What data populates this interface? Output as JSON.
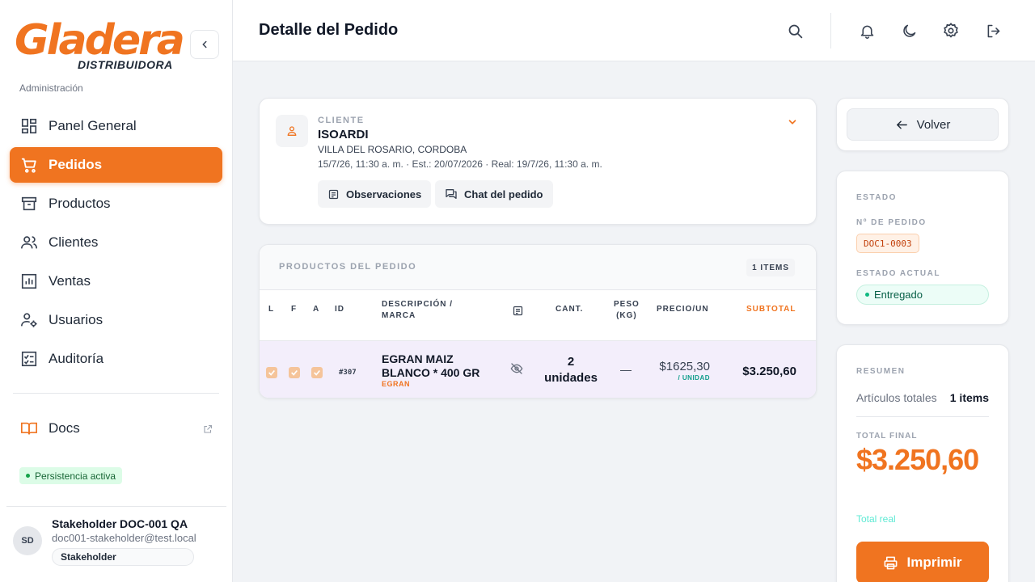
{
  "brand": {
    "logo_main": "Gladera",
    "logo_sub": "DISTRIBUIDORA",
    "accent": "#f07420"
  },
  "sidebar": {
    "section_label": "Administración",
    "items": [
      {
        "label": "Panel General",
        "icon": "dashboard-icon",
        "active": false
      },
      {
        "label": "Pedidos",
        "icon": "cart-icon",
        "active": true
      },
      {
        "label": "Productos",
        "icon": "archive-icon",
        "active": false
      },
      {
        "label": "Clientes",
        "icon": "users-icon",
        "active": false
      },
      {
        "label": "Ventas",
        "icon": "chart-icon",
        "active": false
      },
      {
        "label": "Usuarios",
        "icon": "user-settings-icon",
        "active": false
      },
      {
        "label": "Auditoría",
        "icon": "checklist-icon",
        "active": false
      }
    ],
    "docs_label": "Docs",
    "persistence": "Persistencia activa",
    "user": {
      "initials": "SD",
      "name": "Stakeholder DOC-001 QA",
      "email": "doc001-stakeholder@test.local",
      "role": "Stakeholder"
    }
  },
  "header": {
    "title": "Detalle del Pedido"
  },
  "client": {
    "label": "CLIENTE",
    "name": "ISOARDI",
    "location": "VILLA DEL ROSARIO, CORDOBA",
    "dates": "15/7/26, 11:30 a. m. · Est.: 20/07/2026 · Real: 19/7/26, 11:30 a. m.",
    "observations_label": "Observaciones",
    "chat_label": "Chat del pedido"
  },
  "products": {
    "title": "PRODUCTOS DEL PEDIDO",
    "items_badge": "1 ITEMS",
    "columns": {
      "l": "L",
      "f": "F",
      "a": "A",
      "id": "ID",
      "desc": "DESCRIPCIÓN /\nMARCA",
      "qty": "CANT.",
      "weight": "PESO\n(KG)",
      "price": "PRECIO/UN",
      "subtotal": "SUBTOTAL"
    },
    "rows": [
      {
        "id": "#307",
        "description": "EGRAN MAIZ BLANCO * 400 GR",
        "brand": "EGRAN",
        "qty": "2\nunidades",
        "weight": "—",
        "price": "$1625,30",
        "price_unit": "/ UNIDAD",
        "subtotal": "$3.250,60"
      }
    ]
  },
  "actions": {
    "back_label": "Volver"
  },
  "state": {
    "title": "ESTADO",
    "order_label": "Nº DE PEDIDO",
    "order_number": "DOC1-0003",
    "current_label": "ESTADO ACTUAL",
    "current_status": "Entregado"
  },
  "summary": {
    "title": "RESUMEN",
    "items_label": "Artículos totales",
    "items_value": "1 items",
    "total_label": "TOTAL FINAL",
    "total_value": "$3.250,60",
    "total_note": "Total real",
    "print_label": "Imprimir"
  }
}
